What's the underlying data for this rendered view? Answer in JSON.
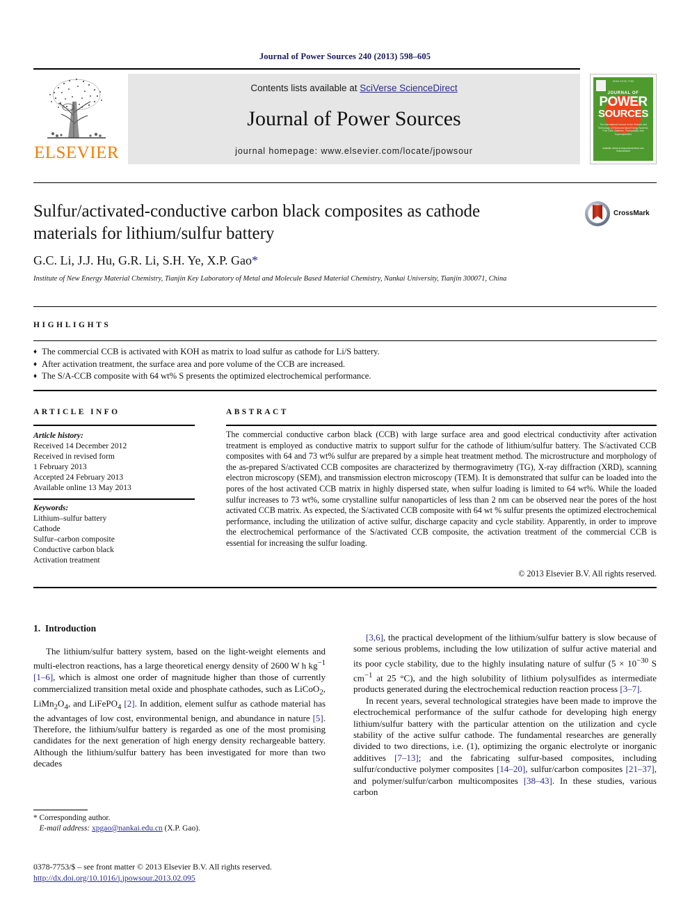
{
  "running_head": "Journal of Power Sources 240 (2013) 598–605",
  "masthead": {
    "contents_prefix": "Contents lists available at ",
    "contents_link": "SciVerse ScienceDirect",
    "journal_name": "Journal of Power Sources",
    "homepage": "journal homepage: www.elsevier.com/locate/jpowsour",
    "publisher_logo_text": "ELSEVIER",
    "cover": {
      "top_line": "ISSN 0378-7753",
      "journal_of": "JOURNAL OF",
      "power": "POWER",
      "sources": "SOURCES",
      "subtitle": "The International Journal on the Science and Technology of Electrochemical Energy Systems: Fuel Cells, Batteries, Photovoltaics and Supercapacitors",
      "footer": "Available online at www.sciencedirect.com\nScienceDirect"
    }
  },
  "article": {
    "title": "Sulfur/activated-conductive carbon black composites as cathode materials for lithium/sulfur battery",
    "authors": "G.C. Li, J.J. Hu, G.R. Li, S.H. Ye, X.P. Gao",
    "author_star": "*",
    "affiliation": "Institute of New Energy Material Chemistry, Tianjin Key Laboratory of Metal and Molecule Based Material Chemistry, Nankai University, Tianjin 300071, China",
    "crossmark_label": "CrossMark"
  },
  "highlights": {
    "heading": "HIGHLIGHTS",
    "bullet_glyph": "♦",
    "items": [
      "The commercial CCB is activated with KOH as matrix to load sulfur as cathode for Li/S battery.",
      "After activation treatment, the surface area and pore volume of the CCB are increased.",
      "The S/A-CCB composite with 64 wt% S presents the optimized electrochemical performance."
    ]
  },
  "article_info": {
    "heading": "ARTICLE INFO",
    "history_label": "Article history:",
    "history": [
      "Received 14 December 2012",
      "Received in revised form",
      "1 February 2013",
      "Accepted 24 February 2013",
      "Available online 13 May 2013"
    ],
    "keywords_label": "Keywords:",
    "keywords": [
      "Lithium–sulfur battery",
      "Cathode",
      "Sulfur–carbon composite",
      "Conductive carbon black",
      "Activation treatment"
    ]
  },
  "abstract": {
    "heading": "ABSTRACT",
    "text": "The commercial conductive carbon black (CCB) with large surface area and good electrical conductivity after activation treatment is employed as conductive matrix to support sulfur for the cathode of lithium/sulfur battery. The S/activated CCB composites with 64 and 73 wt% sulfur are prepared by a simple heat treatment method. The microstructure and morphology of the as-prepared S/activated CCB composites are characterized by thermogravimetry (TG), X-ray diffraction (XRD), scanning electron microscopy (SEM), and transmission electron microscopy (TEM). It is demonstrated that sulfur can be loaded into the pores of the host activated CCB matrix in highly dispersed state, when sulfur loading is limited to 64 wt%. While the loaded sulfur increases to 73 wt%, some crystalline sulfur nanoparticles of less than 2 nm can be observed near the pores of the host activated CCB matrix. As expected, the S/activated CCB composite with 64 wt % sulfur presents the optimized electrochemical performance, including the utilization of active sulfur, discharge capacity and cycle stability. Apparently, in order to improve the electrochemical performance of the S/activated CCB composite, the activation treatment of the commercial CCB is essential for increasing the sulfur loading.",
    "copyright": "© 2013 Elsevier B.V. All rights reserved."
  },
  "body": {
    "section_number": "1.",
    "section_title": "Introduction",
    "left_paragraph_html": "The lithium/sulfur battery system, based on the light-weight elements and multi-electron reactions, has a large theoretical energy density of 2600 W h kg<sup>&minus;1</sup> <span class=\"ref\">[1&ndash;6]</span>, which is almost one order of magnitude higher than those of currently commercialized transition metal oxide and phosphate cathodes, such as LiCoO<sub>2</sub>, LiMn<sub>2</sub>O<sub>4</sub>, and LiFePO<sub>4</sub> <span class=\"ref\">[2]</span>. In addition, element sulfur as cathode material has the advantages of low cost, environmental benign, and abundance in nature <span class=\"ref\">[5]</span>. Therefore, the lithium/sulfur battery is regarded as one of the most promising candidates for the next generation of high energy density rechargeable battery. Although the lithium/sulfur battery has been investigated for more than two decades",
    "right_paragraph1_html": "<span class=\"ref\">[3,6]</span>, the practical development of the lithium/sulfur battery is slow because of some serious problems, including the low utilization of sulfur active material and its poor cycle stability, due to the highly insulating nature of sulfur (5 &times; 10<sup>&minus;30</sup> S cm<sup>&minus;1</sup> at 25 &deg;C), and the high solubility of lithium polysulfides as intermediate products generated during the electrochemical reduction reaction process <span class=\"ref\">[3&ndash;7]</span>.",
    "right_paragraph2_html": "In recent years, several technological strategies have been made to improve the electrochemical performance of the sulfur cathode for developing high energy lithium/sulfur battery with the particular attention on the utilization and cycle stability of the active sulfur cathode. The fundamental researches are generally divided to two directions, i.e. (1), optimizing the organic electrolyte or inorganic additives <span class=\"ref\">[7&ndash;13]</span>; and the fabricating sulfur-based composites, including sulfur/conductive polymer composites <span class=\"ref\">[14&ndash;20]</span>, sulfur/carbon composites <span class=\"ref\">[21&ndash;37]</span>, and polymer/sulfur/carbon multicomposites <span class=\"ref\">[38&ndash;43]</span>. In these studies, various carbon"
  },
  "footnote": {
    "corresponding": "* Corresponding author.",
    "email_label": "E-mail address:",
    "email": "xpgao@nankai.edu.cn",
    "email_suffix": "(X.P. Gao).",
    "frontmatter": "0378-7753/$ – see front matter © 2013 Elsevier B.V. All rights reserved.",
    "doi": "http://dx.doi.org/10.1016/j.jpowsour.2013.02.095"
  },
  "colors": {
    "link": "#2b2b8f",
    "elsevier_orange": "#F07D00",
    "cover_green": "#4e9a2e",
    "cover_orange": "#E8461E",
    "band_gray": "#e6e6e6"
  }
}
